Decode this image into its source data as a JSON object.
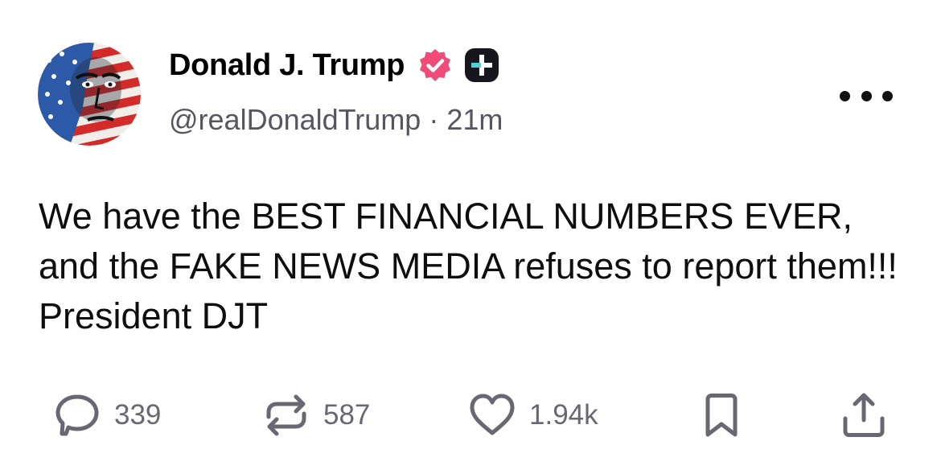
{
  "post": {
    "author_name": "Donald J. Trump",
    "handle": "@realDonaldTrump",
    "separator": "·",
    "time_ago": "21m",
    "text": "We have the BEST FINANCIAL NUMBERS EVER, and the FAKE NEWS MEDIA refuses to report them!!! President DJT"
  },
  "actions": {
    "replies": "339",
    "reposts": "587",
    "likes": "1.94k"
  },
  "icons": {
    "verified": "verified-badge-icon",
    "plus_badge": "plus-badge-icon",
    "more": "more-options-icon",
    "reply": "reply-bubble-icon",
    "repost": "repost-arrows-icon",
    "like": "heart-icon",
    "bookmark": "bookmark-icon",
    "share": "share-upload-icon"
  },
  "colors": {
    "verified_badge": "#ef4c7a",
    "plus_badge_bg": "#17161d",
    "plus_badge_accent": "#4ed0d8",
    "action_gray": "#686873",
    "handle_gray": "#555660"
  }
}
